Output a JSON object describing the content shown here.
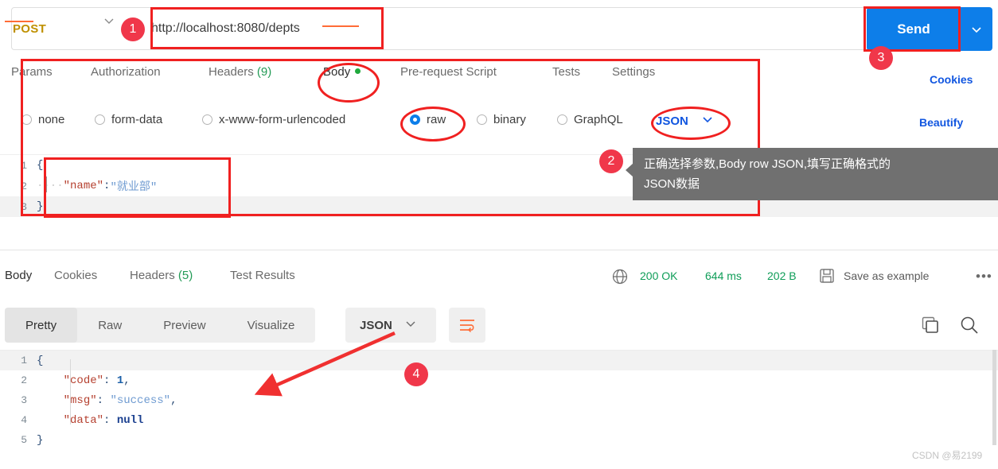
{
  "request": {
    "method": "POST",
    "url": "http://localhost:8080/depts",
    "send_label": "Send",
    "tabs": [
      {
        "label": "Params",
        "active": false
      },
      {
        "label": "Authorization",
        "active": false
      },
      {
        "label": "Headers",
        "count": "(9)",
        "active": false
      },
      {
        "label": "Body",
        "active": true
      },
      {
        "label": "Pre-request Script",
        "active": false
      },
      {
        "label": "Tests",
        "active": false
      },
      {
        "label": "Settings",
        "active": false
      }
    ],
    "cookies_link": "Cookies",
    "beautify_link": "Beautify",
    "body_types": [
      {
        "label": "none",
        "selected": false
      },
      {
        "label": "form-data",
        "selected": false
      },
      {
        "label": "x-www-form-urlencoded",
        "selected": false
      },
      {
        "label": "raw",
        "selected": true
      },
      {
        "label": "binary",
        "selected": false
      },
      {
        "label": "GraphQL",
        "selected": false
      }
    ],
    "raw_format": "JSON",
    "body_lines": [
      {
        "num": "1",
        "open": "{"
      },
      {
        "num": "2",
        "indent": "····",
        "key": "\"name\"",
        "colon": ":",
        "value": "\"就业部\""
      },
      {
        "num": "3",
        "close": "}"
      }
    ]
  },
  "response": {
    "tabs": [
      {
        "label": "Body",
        "active": true
      },
      {
        "label": "Cookies",
        "active": false
      },
      {
        "label": "Headers",
        "count": "(5)",
        "active": false
      },
      {
        "label": "Test Results",
        "active": false
      }
    ],
    "status": "200 OK",
    "time": "644 ms",
    "size": "202 B",
    "save_as_example": "Save as example",
    "more_label": "•••",
    "view_modes": [
      {
        "label": "Pretty",
        "active": true
      },
      {
        "label": "Raw",
        "active": false
      },
      {
        "label": "Preview",
        "active": false
      },
      {
        "label": "Visualize",
        "active": false
      }
    ],
    "format": "JSON",
    "body_lines": [
      {
        "num": "1",
        "open": "{"
      },
      {
        "num": "2",
        "key": "\"code\"",
        "colon": ": ",
        "num_val": "1",
        "comma": ","
      },
      {
        "num": "3",
        "key": "\"msg\"",
        "colon": ": ",
        "str_val": "\"success\"",
        "comma": ","
      },
      {
        "num": "4",
        "key": "\"data\"",
        "colon": ": ",
        "null_val": "null"
      },
      {
        "num": "5",
        "close": "}"
      }
    ]
  },
  "annotations": {
    "badge1": "1",
    "badge2": "2",
    "badge3": "3",
    "badge4": "4",
    "tooltip_line1": "正确选择参数,Body row JSON,填写正确格式的",
    "tooltip_line2": "JSON数据"
  },
  "watermark": "CSDN @易2199",
  "colors": {
    "accent_orange": "#ff6c37",
    "send_blue": "#0d7ee9",
    "link_blue": "#1156e0",
    "annotation_red": "#f02020",
    "badge_red": "#f0374a",
    "method_post": "#bf9000",
    "status_green": "#0f9d58"
  }
}
